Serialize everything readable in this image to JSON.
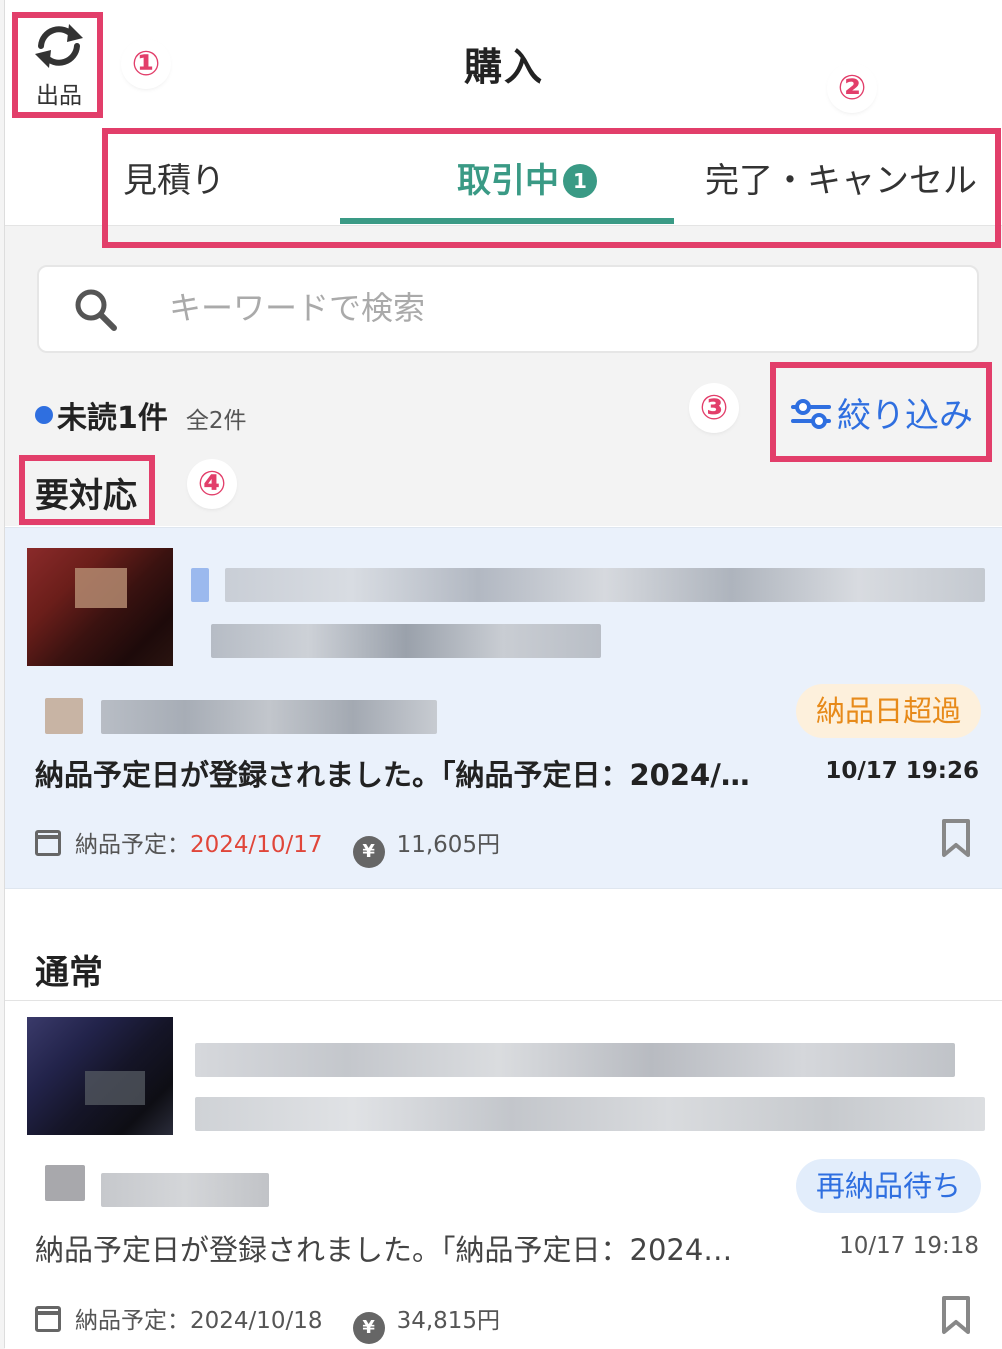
{
  "header": {
    "title": "購入",
    "switch_label": "出品"
  },
  "tabs": [
    {
      "label": "見積り",
      "active": false
    },
    {
      "label": "取引中",
      "active": true,
      "badge": "1"
    },
    {
      "label": "完了・キャンセル",
      "active": false
    }
  ],
  "search": {
    "placeholder": "キーワードで検索"
  },
  "counts": {
    "unread": "未読1件",
    "total": "全2件"
  },
  "filter_label": "絞り込み",
  "sections": {
    "urgent": "要対応",
    "normal": "通常"
  },
  "orders": [
    {
      "status_tag": "納品日超過",
      "tag_color": "#e78a1a",
      "tag_bg": "#fdf0dc",
      "message": "納品予定日が登録されました。「納品予定日：2024/…",
      "time": "10/17 19:26",
      "delivery_label": "納品予定：",
      "delivery_date": "2024/10/17",
      "price": "11,605円",
      "unread": true
    },
    {
      "status_tag": "再納品待ち",
      "tag_color": "#2f6fe0",
      "tag_bg": "#e2edfb",
      "message": "納品予定日が登録されました。「納品予定日：2024…",
      "time": "10/17 19:18",
      "delivery_label": "納品予定：",
      "delivery_date": "2024/10/18",
      "price": "34,815円",
      "unread": false
    }
  ],
  "annotations": [
    "①",
    "②",
    "③",
    "④"
  ],
  "colors": {
    "accent_green": "#3a9a85",
    "link_blue": "#2f6fe0",
    "overdue_red": "#e0463a",
    "annotation_pink": "#e23e6a"
  }
}
